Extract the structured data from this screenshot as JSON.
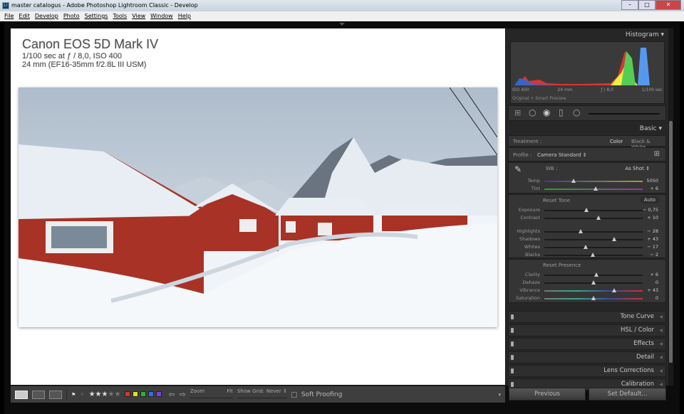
{
  "window": {
    "title": "master catalogus - Adobe Photoshop Lightroom Classic - Develop",
    "app_badge": "Lr"
  },
  "menu": [
    "File",
    "Edit",
    "Develop",
    "Photo",
    "Settings",
    "Tools",
    "View",
    "Window",
    "Help"
  ],
  "info_overlay": {
    "camera": "Canon EOS 5D Mark IV",
    "exposure": "1/100 sec at ƒ / 8,0, ISO 400",
    "lens": "24 mm (EF16-35mm f/2.8L III USM)"
  },
  "histogram": {
    "title": "Histogram",
    "iso": "ISO 400",
    "focal": "24 mm",
    "aperture": "ƒ / 8,0",
    "shutter": "1/100 sec",
    "preview": "Original + Smart Preview"
  },
  "basic": {
    "title": "Basic",
    "treatment_label": "Treatment :",
    "color": "Color",
    "bw": "Black & White",
    "profile_label": "Profile :",
    "profile": "Camera Standard ⇕",
    "wb_label": "WB :",
    "wb": "As Shot ⇕",
    "reset_tone": "Reset Tone",
    "auto": "Auto",
    "reset_presence": "Reset Presence",
    "wb_sliders": [
      {
        "label": "Temp",
        "value": "5050",
        "pos": 0.3
      },
      {
        "label": "Tint",
        "value": "+ 6",
        "pos": 0.52
      }
    ],
    "tone_sliders": [
      {
        "label": "Exposure",
        "value": "− 0,75",
        "pos": 0.43
      },
      {
        "label": "Contrast",
        "value": "+ 10",
        "pos": 0.55
      }
    ],
    "tone2_sliders": [
      {
        "label": "Highlights",
        "value": "− 28",
        "pos": 0.37
      },
      {
        "label": "Shadows",
        "value": "+ 43",
        "pos": 0.71
      },
      {
        "label": "Whites",
        "value": "− 17",
        "pos": 0.42
      },
      {
        "label": "Blacks",
        "value": "− 2",
        "pos": 0.49
      }
    ],
    "presence_sliders": [
      {
        "label": "Clarity",
        "value": "+ 6",
        "pos": 0.53
      },
      {
        "label": "Dehaze",
        "value": "0",
        "pos": 0.5
      },
      {
        "label": "Vibrance",
        "value": "+ 43",
        "pos": 0.71
      },
      {
        "label": "Saturation",
        "value": "0",
        "pos": 0.5
      }
    ]
  },
  "panels": [
    "Tone Curve",
    "HSL / Color",
    "Effects",
    "Detail",
    "Lens Corrections",
    "Calibration"
  ],
  "buttons": {
    "previous": "Previous",
    "set_default": "Set Default..."
  },
  "toolbar": {
    "rating": 3,
    "max_rating": 5,
    "labels": [
      "#e03030",
      "#e0e020",
      "#30b030",
      "#3070e0",
      "#8040e0"
    ],
    "zoom_label": "Zoom",
    "zoom_value": "Fit",
    "grid_label": "Show Grid:",
    "grid_value": "Never ⇕",
    "soft_proofing": "Soft Proofing"
  }
}
